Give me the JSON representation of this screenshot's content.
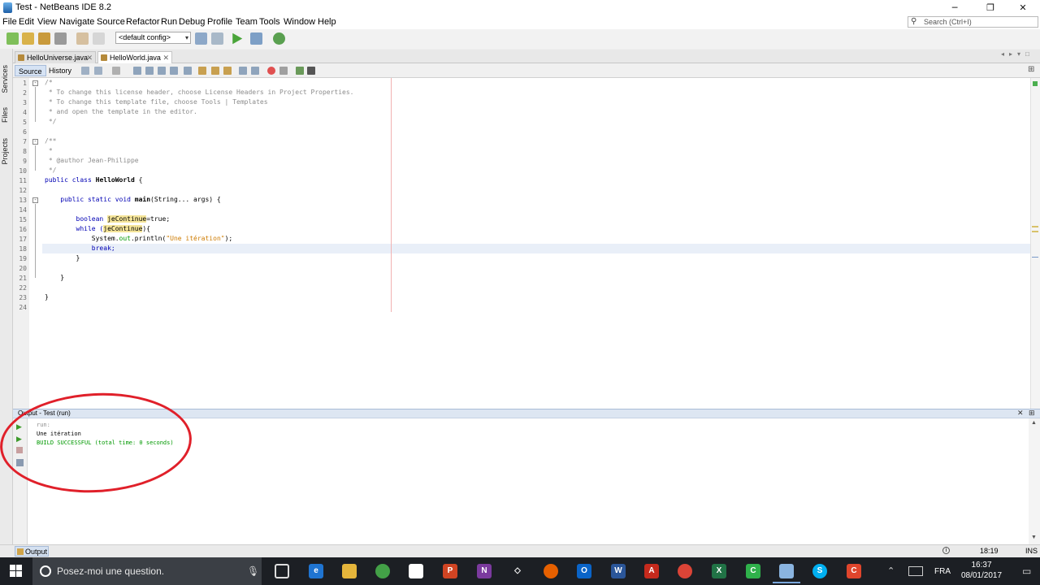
{
  "window": {
    "title": "Test - NetBeans IDE 8.2",
    "controls": {
      "minimize": "─",
      "maximize": "❐",
      "close": "✕"
    }
  },
  "menu": {
    "items": [
      "File",
      "Edit",
      "View",
      "Navigate",
      "Source",
      "Refactor",
      "Run",
      "Debug",
      "Profile",
      "Team",
      "Tools",
      "Window",
      "Help"
    ]
  },
  "search": {
    "placeholder": "Search (Ctrl+I)",
    "icon": "search-icon"
  },
  "toolbar": {
    "config_value": "<default config>"
  },
  "side_panels": [
    "Services",
    "Files",
    "Projects"
  ],
  "tabs": [
    {
      "label": "HelloUniverse.java",
      "active": false
    },
    {
      "label": "HelloWorld.java",
      "active": true
    }
  ],
  "editor_toolbar": {
    "source_label": "Source",
    "history_label": "History"
  },
  "editor": {
    "line_numbers": [
      "1",
      "2",
      "3",
      "4",
      "5",
      "6",
      "7",
      "8",
      "9",
      "10",
      "11",
      "12",
      "13",
      "14",
      "15",
      "16",
      "17",
      "18",
      "19",
      "20",
      "21",
      "22",
      "23",
      "24"
    ],
    "lines": {
      "l1": "/*",
      "l2": " * To change this license header, choose License Headers in Project Properties.",
      "l3": " * To change this template file, choose Tools | Templates",
      "l4": " * and open the template in the editor.",
      "l5": " */",
      "l7": "/**",
      "l8": " *",
      "l9": " * @author Jean-Philippe",
      "l10": " */",
      "l11a": "public class ",
      "l11b": "HelloWorld",
      "l11c": " {",
      "l13a": "    public static void ",
      "l13b": "main",
      "l13c": "(String... args) {",
      "l15a": "        boolean ",
      "l15b": "jeContinue",
      "l15c": "=true;",
      "l16a": "        while (",
      "l16b": "jeContinue",
      "l16c": "){",
      "l17a": "            System.",
      "l17b": "out",
      "l17c": ".println(",
      "l17d": "\"Une itération\"",
      "l17e": ");",
      "l18": "            break;",
      "l19": "        }",
      "l21": "    }",
      "l23": "}"
    }
  },
  "output": {
    "title": "Output - Test (run)",
    "lines": [
      "run:",
      "Une itération",
      "BUILD SUCCESSFUL (total time: 0 seconds)"
    ]
  },
  "statusbar": {
    "output_tab": "Output",
    "position": "18:19",
    "mode": "INS"
  },
  "taskbar": {
    "search_placeholder": "Posez-moi une question.",
    "language": "FRA",
    "time": "16:37",
    "date": "08/01/2017"
  },
  "colors": {
    "annotation_circle": "#e0202a",
    "keyword": "#0000b4",
    "string": "#ce7b00",
    "comment": "#8c8c8c",
    "build_success": "#009900"
  }
}
